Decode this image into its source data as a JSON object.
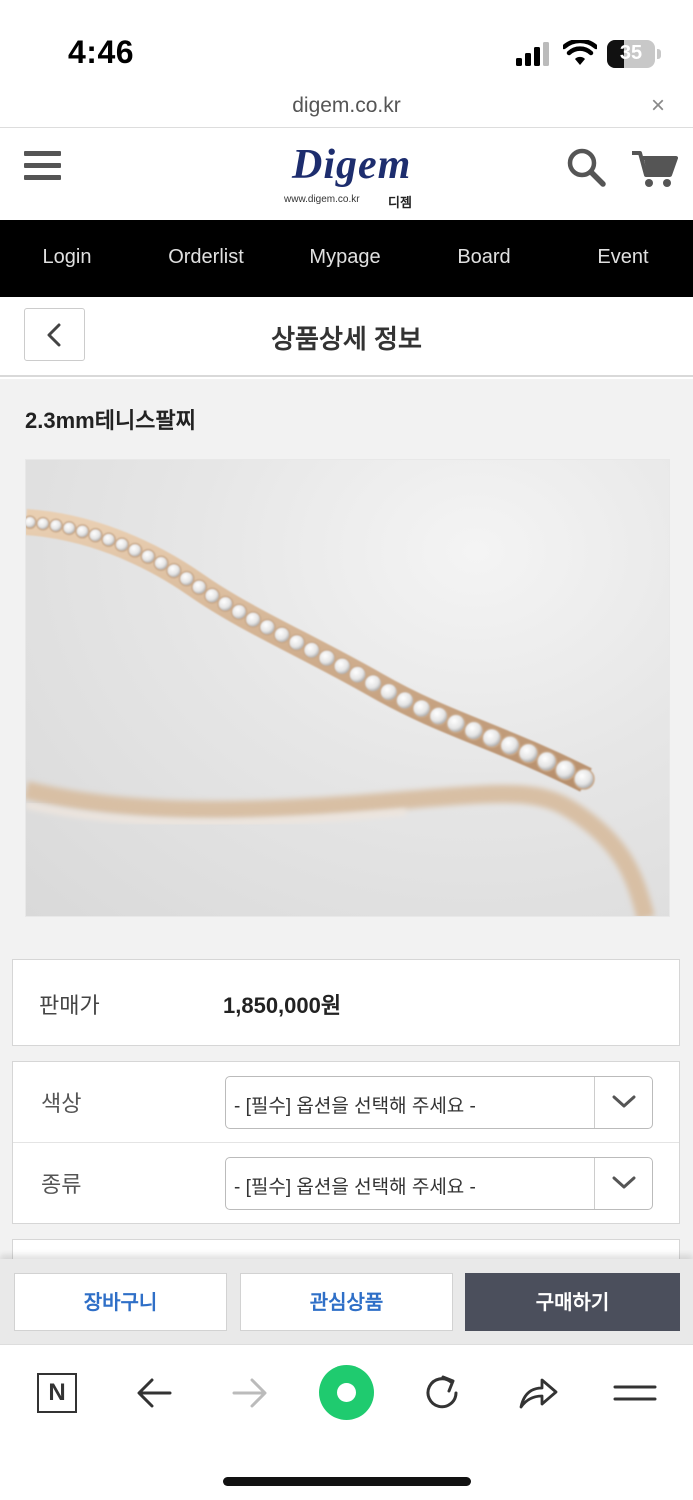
{
  "status_bar": {
    "time": "4:46",
    "battery": "35",
    "battery_level": 0.35
  },
  "browser": {
    "url": "digem.co.kr",
    "close": "×"
  },
  "header": {
    "logo_text": "Digem",
    "logo_sub": "www.digem.co.kr",
    "logo_kor": "디젬"
  },
  "nav": {
    "items": [
      "Login",
      "Orderlist",
      "Mypage",
      "Board",
      "Event"
    ]
  },
  "page": {
    "title": "상품상세 정보"
  },
  "product": {
    "name": "2.3mm테니스팔찌",
    "price_label": "판매가",
    "price": "1,850,000원"
  },
  "options": [
    {
      "label": "색상",
      "placeholder": "- [필수] 옵션을 선택해 주세요 -"
    },
    {
      "label": "종류",
      "placeholder": "- [필수] 옵션을 선택해 주세요 -"
    }
  ],
  "actions": {
    "cart": "장바구니",
    "wishlist": "관심상품",
    "buy": "구매하기"
  },
  "toolbar": {
    "home_letter": "N"
  },
  "colors": {
    "nav_bg": "#000000",
    "accent_blue": "#2f6fc7",
    "buy_bg": "#4b4f5c",
    "green": "#1fcb6f"
  }
}
